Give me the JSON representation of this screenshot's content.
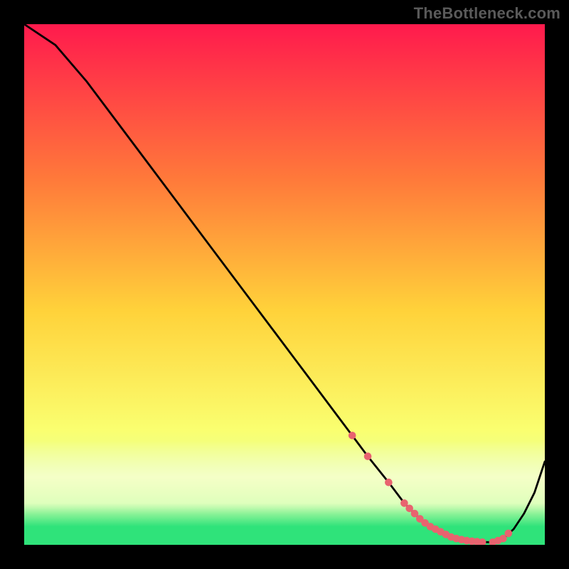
{
  "watermark": "TheBottleneck.com",
  "colors": {
    "bg": "#000000",
    "grad_top": "#ff1a4d",
    "grad_mid1": "#ff7a3a",
    "grad_mid2": "#ffd23a",
    "grad_low1": "#faff70",
    "grad_low2": "#d8ffb0",
    "grad_bot": "#2fe37a",
    "curve": "#000000",
    "marker": "#e8636f"
  },
  "chart_data": {
    "type": "line",
    "title": "",
    "xlabel": "",
    "ylabel": "",
    "xlim": [
      0,
      100
    ],
    "ylim": [
      0,
      100
    ],
    "x": [
      0,
      6,
      12,
      18,
      24,
      30,
      36,
      42,
      48,
      54,
      60,
      63,
      66,
      70,
      73,
      76,
      79,
      82,
      85,
      88,
      90,
      92,
      94,
      96,
      98,
      100
    ],
    "series": [
      {
        "name": "bottleneck-curve",
        "values": [
          100,
          96,
          89,
          81,
          73,
          65,
          57,
          49,
          41,
          33,
          25,
          21,
          17,
          12,
          8,
          5,
          3,
          1.5,
          0.8,
          0.5,
          0.5,
          1.2,
          3,
          6,
          10,
          16
        ]
      }
    ],
    "markers": {
      "name": "highlight-dots",
      "x": [
        63,
        66,
        70,
        73,
        74,
        75,
        76,
        77,
        78,
        79,
        80,
        81,
        82,
        83,
        84,
        85,
        86,
        87,
        88,
        90,
        91,
        92,
        93
      ],
      "y": [
        21,
        17,
        12,
        8,
        7,
        6,
        5,
        4.2,
        3.5,
        3,
        2.5,
        2,
        1.5,
        1.2,
        1,
        0.8,
        0.7,
        0.6,
        0.5,
        0.5,
        0.8,
        1.2,
        2.2
      ]
    }
  }
}
